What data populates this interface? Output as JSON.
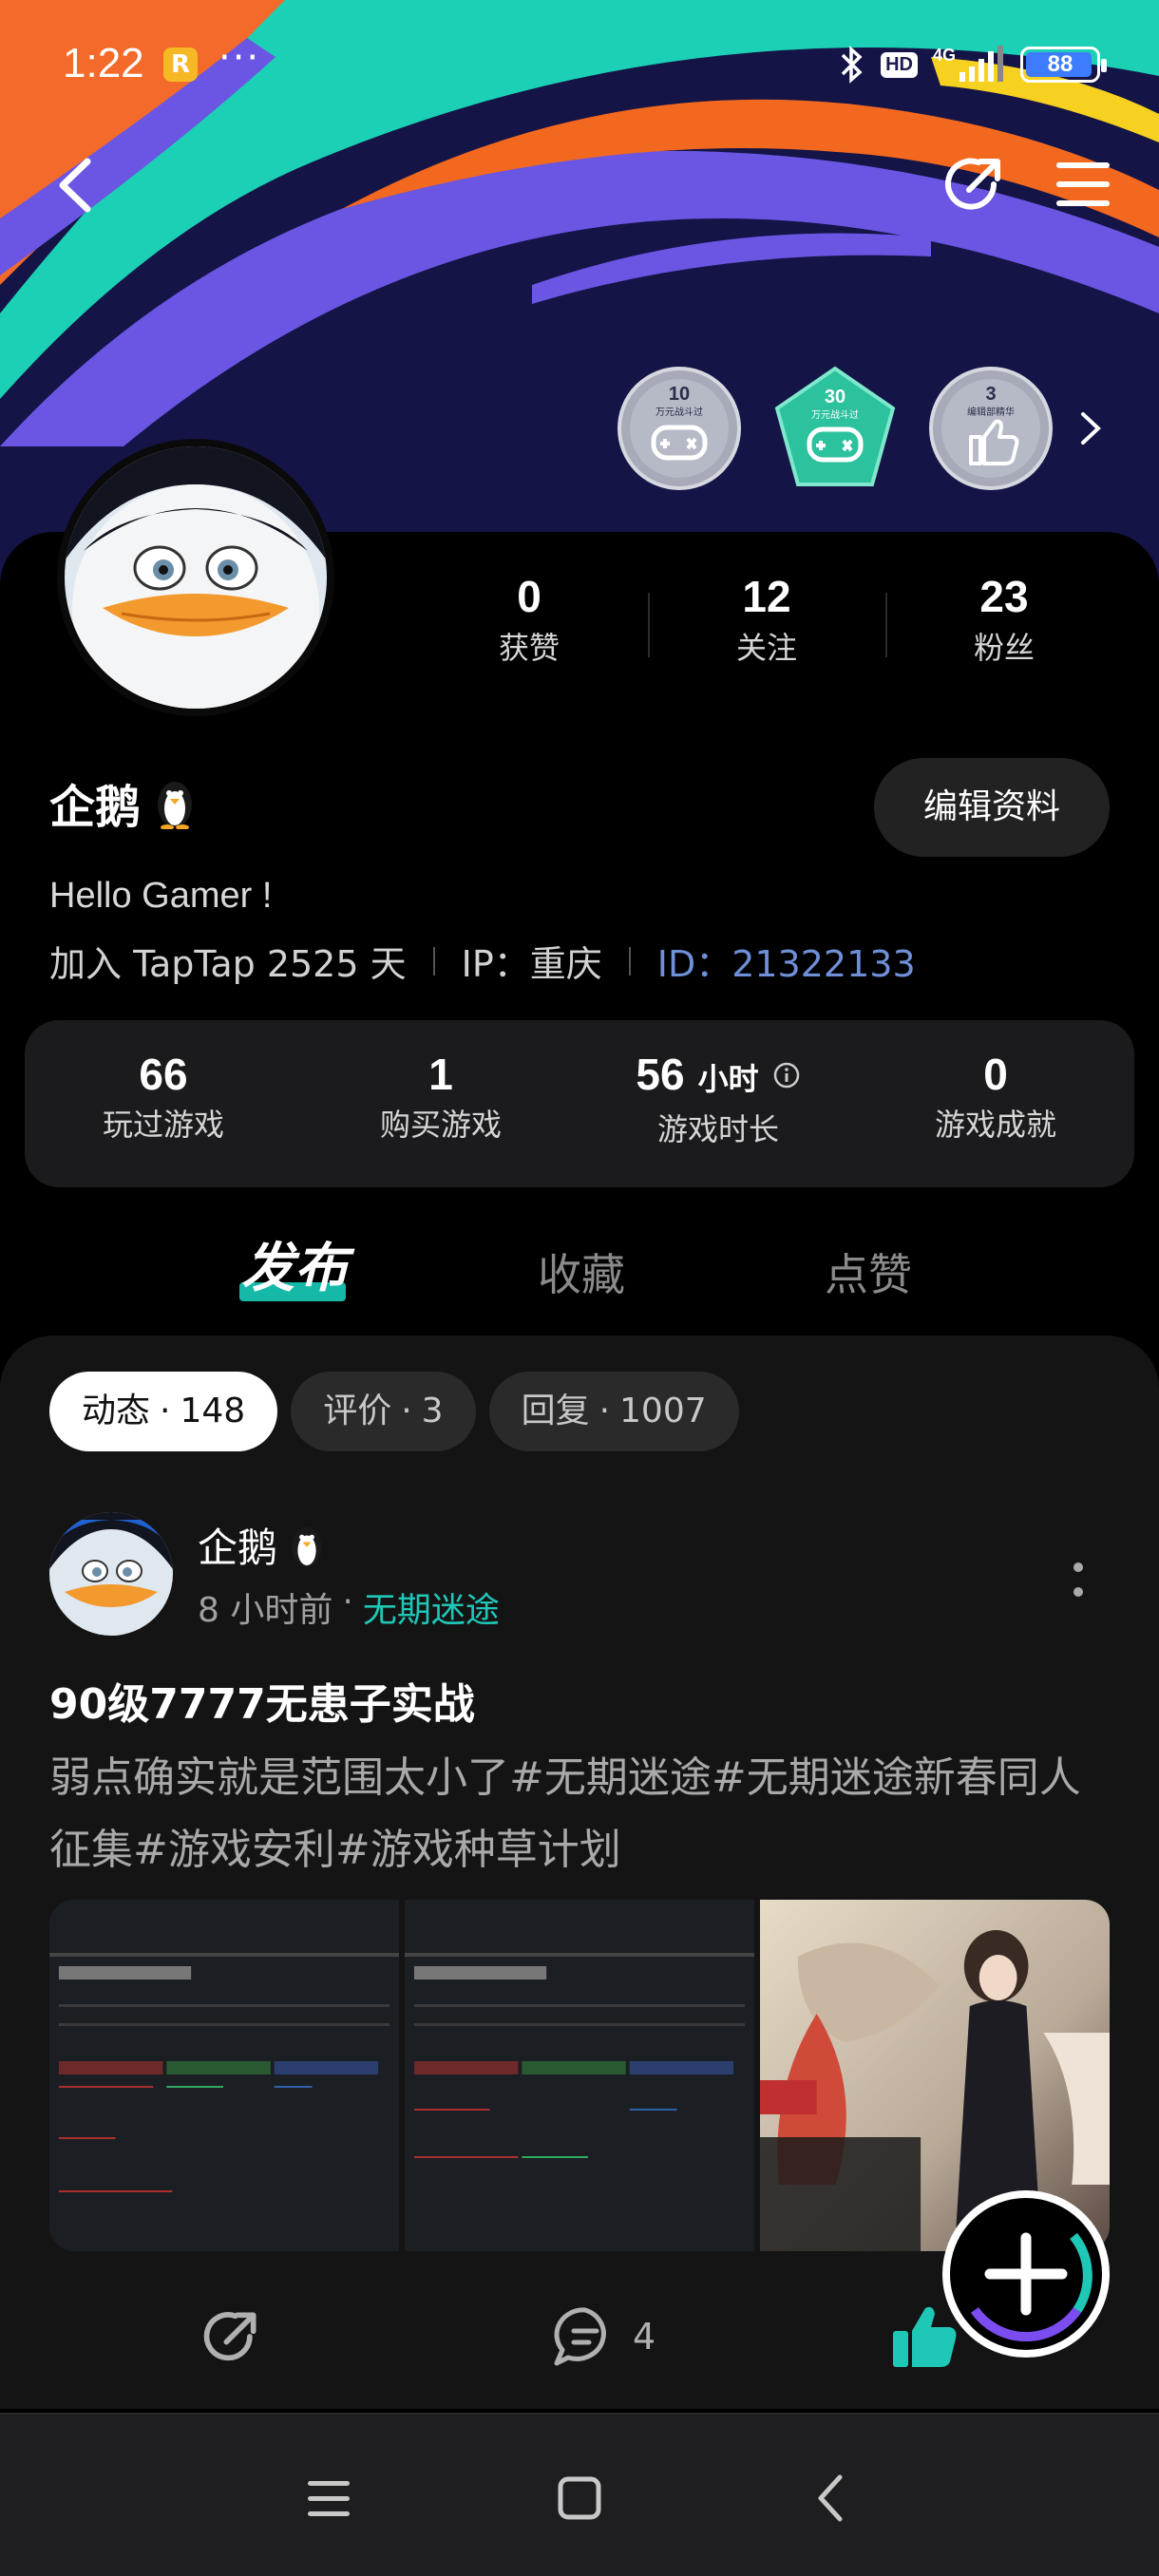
{
  "status_bar": {
    "time": "1:22",
    "app_badge": "R",
    "dots": "···",
    "hd": "HD",
    "network": "4G",
    "battery": "88"
  },
  "header": {
    "badges": [
      {
        "number": "10",
        "caption": "万元战斗过",
        "color": "#a7aab8"
      },
      {
        "number": "30",
        "caption": "万元战斗过",
        "color": "#2bc29d"
      },
      {
        "number": "3",
        "caption": "编辑部精华",
        "color": "#a7aab8"
      }
    ]
  },
  "profile": {
    "stats": [
      {
        "value": "0",
        "label": "获赞"
      },
      {
        "value": "12",
        "label": "关注"
      },
      {
        "value": "23",
        "label": "粉丝"
      }
    ],
    "username": "企鹅",
    "edit_label": "编辑资料",
    "bio": "Hello Gamer !",
    "joined": "加入 TapTap 2525 天",
    "ip": "IP：重庆",
    "id": "ID：21322133"
  },
  "game_stats": {
    "played": {
      "value": "66",
      "label": "玩过游戏"
    },
    "bought": {
      "value": "1",
      "label": "购买游戏"
    },
    "hours": {
      "value": "56",
      "unit": "小时",
      "label": "游戏时长"
    },
    "achievements": {
      "value": "0",
      "label": "游戏成就"
    }
  },
  "tabs": [
    "发布",
    "收藏",
    "点赞"
  ],
  "chips": [
    {
      "label": "动态",
      "count": "148"
    },
    {
      "label": "评价",
      "count": "3"
    },
    {
      "label": "回复",
      "count": "1007"
    }
  ],
  "post": {
    "author": "企鹅",
    "time": "8 小时前",
    "dot": "·",
    "game": "无期迷途",
    "title": "90级7777无患子实战",
    "body": "弱点确实就是范围太小了#无期迷途#无期迷途新春同人征集#游戏安利#游戏种草计划",
    "comments": "4"
  },
  "colors": {
    "accent": "#16b8a8",
    "id_link": "#6f8fd8",
    "like": "#1fc7b6"
  }
}
